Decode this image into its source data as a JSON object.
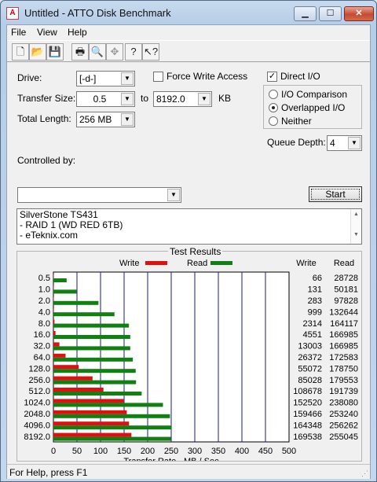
{
  "window": {
    "title": "Untitled - ATTO Disk Benchmark",
    "app_icon": "atto-icon"
  },
  "menu": [
    "File",
    "View",
    "Help"
  ],
  "toolbar": [
    {
      "name": "new-icon",
      "glyph": "🗋"
    },
    {
      "name": "open-icon",
      "glyph": "📂"
    },
    {
      "name": "save-icon",
      "glyph": "💾"
    },
    {
      "name": "print-icon",
      "glyph": "🖶"
    },
    {
      "name": "print-preview-icon",
      "glyph": "🔍"
    },
    {
      "name": "move-icon",
      "glyph": "✥"
    },
    {
      "name": "help-icon",
      "glyph": "?"
    },
    {
      "name": "context-help-icon",
      "glyph": "↖?"
    }
  ],
  "form": {
    "drive_label": "Drive:",
    "drive_value": "[-d-]",
    "force_write_label": "Force Write Access",
    "force_write_checked": false,
    "direct_io_label": "Direct I/O",
    "direct_io_checked": true,
    "transfer_size_label": "Transfer Size:",
    "transfer_from": "0.5",
    "to_label": "to",
    "transfer_to": "8192.0",
    "unit_label": "KB",
    "total_length_label": "Total Length:",
    "total_length_value": "256 MB",
    "io_options": [
      "I/O Comparison",
      "Overlapped I/O",
      "Neither"
    ],
    "io_selected": 1,
    "queue_depth_label": "Queue Depth:",
    "queue_depth_value": "4",
    "controlled_by_label": "Controlled by:",
    "controlled_by_value": "",
    "start_label": "Start"
  },
  "notes_lines": [
    "SilverStone TS431",
    "- RAID 1 (WD RED 6TB)",
    "- eTeknix.com"
  ],
  "results_title": "Test Results",
  "status_text": "For Help, press F1",
  "colors": {
    "write": "#e01010",
    "read": "#108010",
    "grid": "#1a1a8a"
  },
  "chart_data": {
    "type": "bar",
    "orientation": "horizontal",
    "categories": [
      "0.5",
      "1.0",
      "2.0",
      "4.0",
      "8.0",
      "16.0",
      "32.0",
      "64.0",
      "128.0",
      "256.0",
      "512.0",
      "1024.0",
      "2048.0",
      "4096.0",
      "8192.0"
    ],
    "series": [
      {
        "name": "Write",
        "values": [
          66,
          131,
          283,
          999,
          2314,
          4551,
          13003,
          26372,
          55072,
          85028,
          108678,
          152520,
          159466,
          164348,
          169538
        ]
      },
      {
        "name": "Read",
        "values": [
          28728,
          50181,
          97828,
          132644,
          164117,
          166985,
          166985,
          172583,
          178750,
          179553,
          191739,
          238080,
          253240,
          256262,
          255045
        ]
      }
    ],
    "bar_scale_note": "",
    "xlabel": "Transfer Rate - MB / Sec",
    "xlim": [
      0,
      500
    ],
    "xticks": [
      "0",
      "50",
      "100",
      "150",
      "200",
      "250",
      "300",
      "350",
      "400",
      "450",
      "500"
    ],
    "column_headers": [
      "Write",
      "Read"
    ],
    "legend": [
      "Write",
      "Read"
    ]
  }
}
